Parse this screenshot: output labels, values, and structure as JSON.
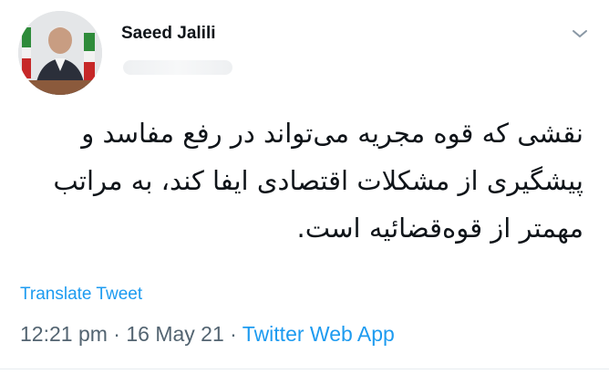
{
  "tweet": {
    "author_name": "Saeed Jalili",
    "text": "نقشی که قوه مجریه می‌تواند در رفع مفاسد و پیشگیری از مشکلات اقتصادی ایفا کند، به مراتب مهمتر از قوه‌قضائیه است.",
    "translate_label": "Translate Tweet",
    "time": "12:21 pm",
    "date": "16 May 21",
    "source_app": "Twitter Web App"
  },
  "icons": {
    "menu": "chevron-down-icon"
  },
  "colors": {
    "link": "#1d9bf0",
    "meta": "#536471",
    "text": "#0f1419"
  }
}
